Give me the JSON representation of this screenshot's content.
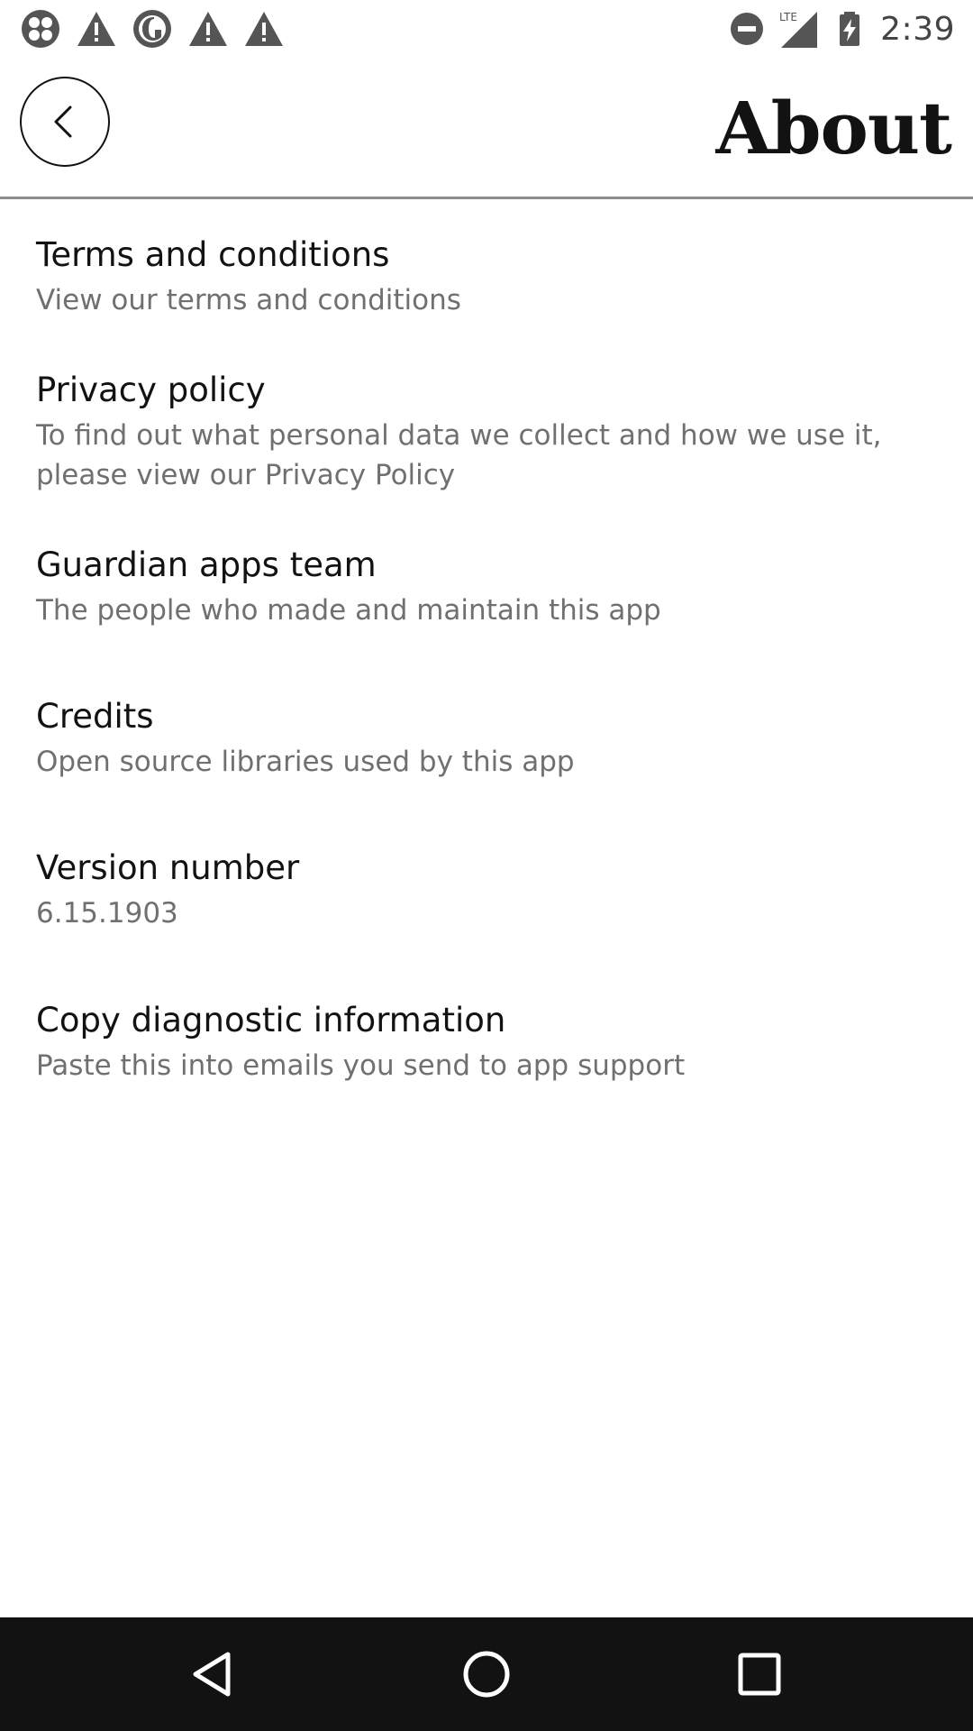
{
  "status_bar": {
    "time": "2:39",
    "left_icons": [
      "app-notification-icon",
      "warning-icon",
      "guardian-icon",
      "warning-icon",
      "warning-icon"
    ],
    "right_icons": [
      "do-not-disturb-icon",
      "lte-signal-icon",
      "battery-charging-icon"
    ],
    "network_label": "LTE"
  },
  "app_bar": {
    "title": "About",
    "back_icon": "chevron-left-icon"
  },
  "settings": {
    "items": [
      {
        "title": "Terms and conditions",
        "summary": "View our terms and conditions"
      },
      {
        "title": "Privacy policy",
        "summary": "To find out what personal data we collect and how we use it, please view our Privacy Policy"
      },
      {
        "title": "Guardian apps team",
        "summary": "The people who made and maintain this app"
      },
      {
        "title": "Credits",
        "summary": "Open source libraries used by this app"
      },
      {
        "title": "Version number",
        "summary": "6.15.1903"
      },
      {
        "title": "Copy diagnostic information",
        "summary": "Paste this into emails you send to app support"
      }
    ]
  },
  "nav_bar": {
    "icons": [
      "back-triangle-icon",
      "home-circle-icon",
      "recents-square-icon"
    ]
  },
  "colors": {
    "text_primary": "#121212",
    "text_secondary": "#707070",
    "divider": "#8e8e8e",
    "nav_background": "#121212"
  }
}
